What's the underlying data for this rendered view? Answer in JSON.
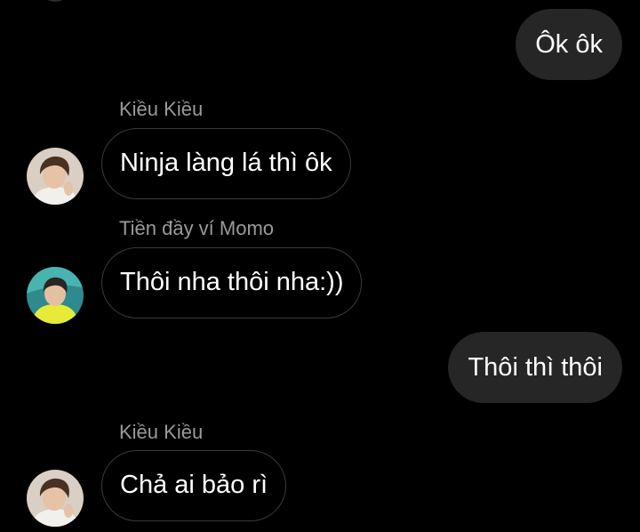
{
  "conversation": {
    "messages": [
      {
        "direction": "outgoing",
        "text": "Ôk ôk"
      },
      {
        "direction": "incoming",
        "sender": "Kiều Kiều",
        "text": "Ninja làng lá thì ôk",
        "avatar_icon": "user-avatar-icon"
      },
      {
        "direction": "incoming",
        "sender": "Tiền đầy ví Momo",
        "text": "Thôi nha thôi nha:))",
        "avatar_icon": "user-avatar-icon"
      },
      {
        "direction": "outgoing",
        "text": "Thôi thì thôi"
      },
      {
        "direction": "incoming",
        "sender": "Kiều Kiều",
        "text": "Chả ai bảo rì",
        "avatar_icon": "user-avatar-icon"
      }
    ]
  },
  "colors": {
    "background": "#000000",
    "outgoing_bubble": "#262626",
    "incoming_bubble_border": "#3a3a3a",
    "sender_name": "#9a9a9a",
    "text": "#ffffff"
  }
}
